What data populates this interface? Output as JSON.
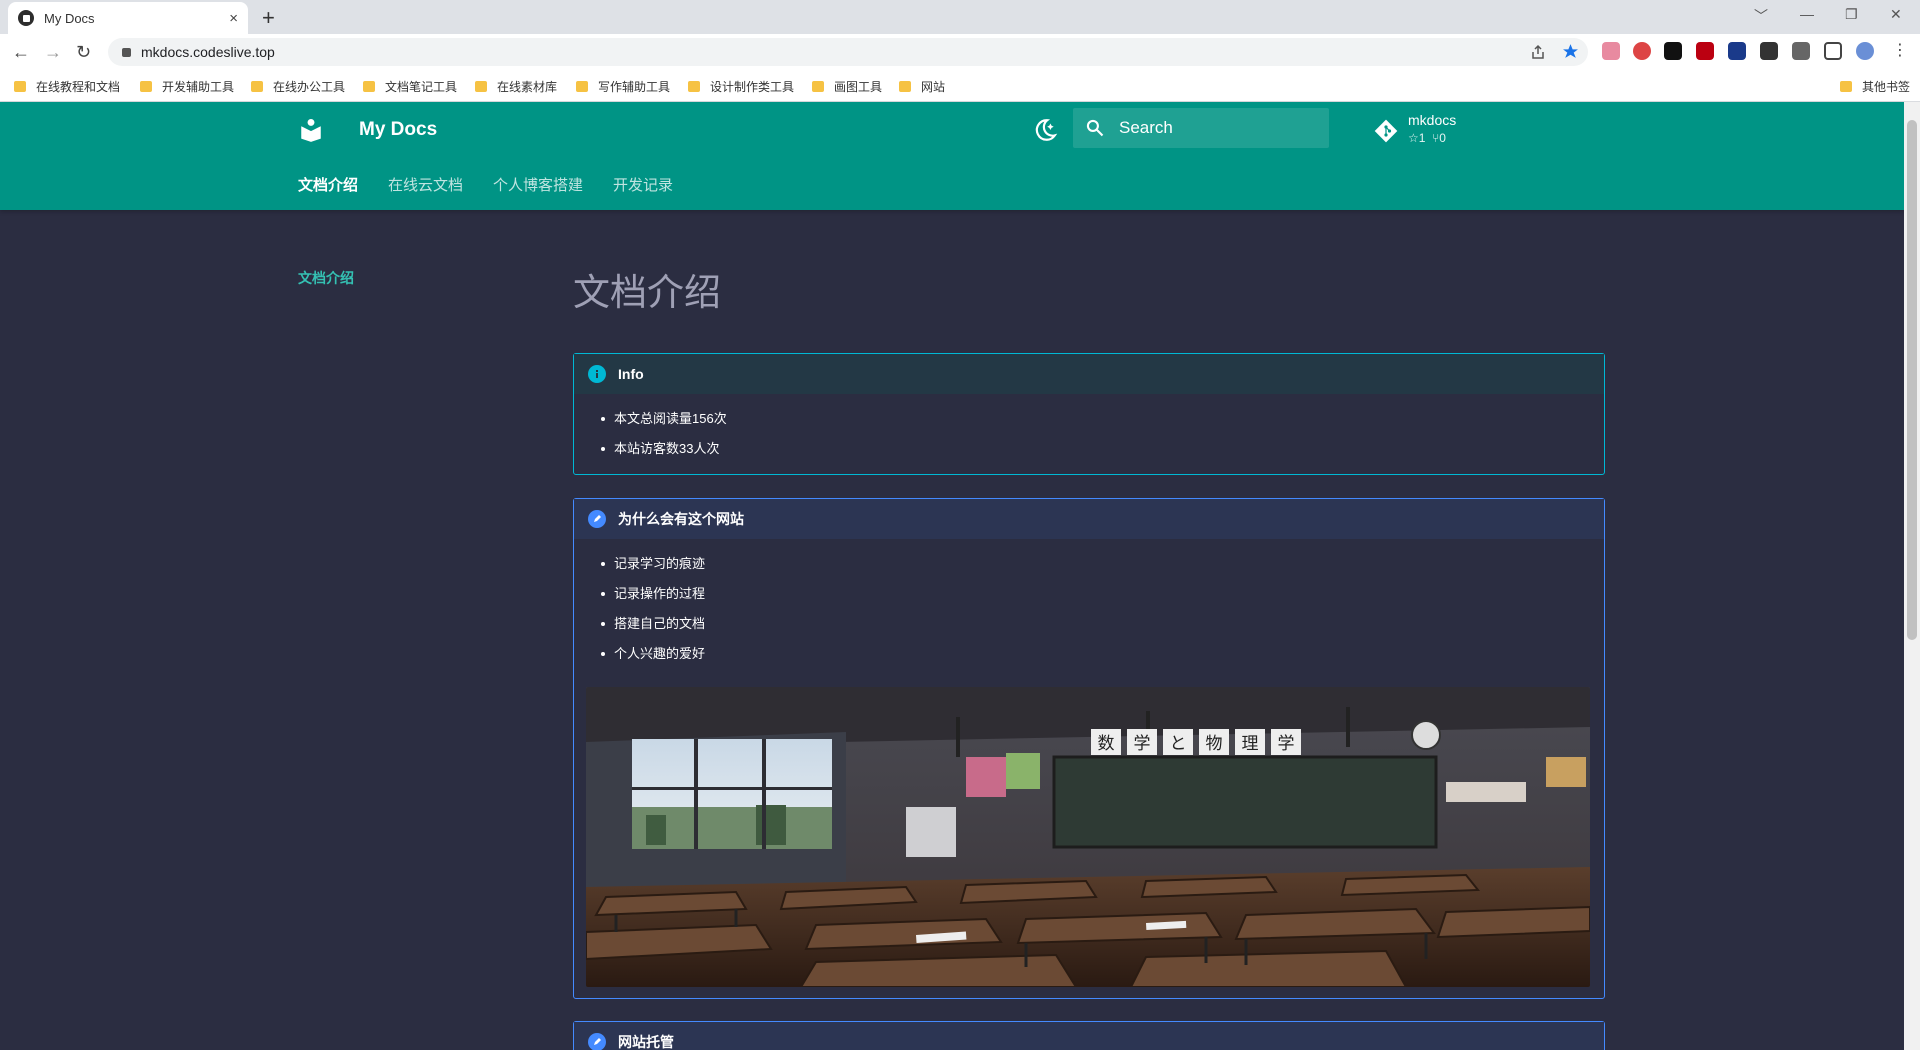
{
  "browser": {
    "tab_title": "My Docs",
    "tab_close": "×",
    "new_tab": "+",
    "url": "mkdocs.codeslive.top",
    "window_controls": [
      "﹀",
      "—",
      "❐",
      "✕"
    ],
    "nav": {
      "back": "←",
      "forward": "→",
      "reload": "↻"
    },
    "bookmarks": [
      "在线教程和文档",
      "开发辅助工具",
      "在线办公工具",
      "文档笔记工具",
      "在线素材库",
      "写作辅助工具",
      "设计制作类工具",
      "画图工具",
      "网站"
    ],
    "other_bookmarks": "其他书签"
  },
  "header": {
    "site_title": "My Docs",
    "search_placeholder": "Search",
    "repo_name": "mkdocs",
    "repo_stars": "☆1",
    "repo_forks": "⑂0",
    "tabs": [
      "文档介绍",
      "在线云文档",
      "个人博客搭建",
      "开发记录"
    ],
    "active_tab": "文档介绍"
  },
  "sidebar": {
    "items": [
      "文档介绍"
    ]
  },
  "main": {
    "title": "文档介绍",
    "admonitions": [
      {
        "type": "info",
        "title": "Info",
        "items": [
          "本文总阅读量156次",
          "本站访客数33人次"
        ]
      },
      {
        "type": "note",
        "title": "为什么会有这个网站",
        "items": [
          "记录学习的痕迹",
          "记录操作的过程",
          "搭建自己的文档",
          "个人兴趣的爱好"
        ]
      },
      {
        "type": "note",
        "title": "网站托管",
        "items": []
      }
    ],
    "image_blackboard_text": [
      "数",
      "学",
      "と",
      "物",
      "理",
      "学"
    ]
  },
  "colors": {
    "primary": "#009485",
    "background": "#2b2d41",
    "accent_link": "#34c1b3",
    "info": "#00b8d4",
    "note": "#448aff"
  }
}
